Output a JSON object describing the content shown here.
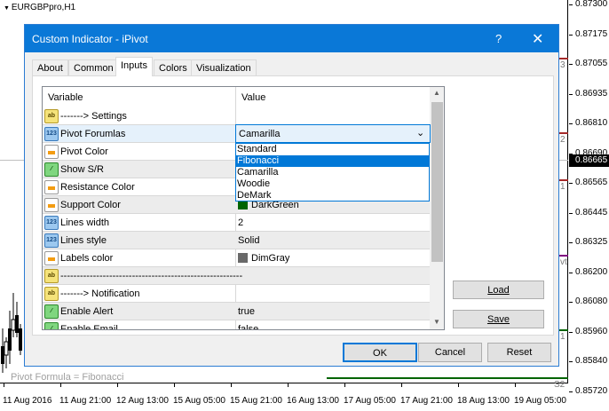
{
  "chart": {
    "symbol": "EURGBPpro,H1",
    "price_labels": [
      "0.87300",
      "0.87175",
      "0.87055",
      "0.86935",
      "0.86810",
      "0.86690",
      "0.86565",
      "0.86445",
      "0.86325",
      "0.86200",
      "0.86080",
      "0.85960",
      "0.85840",
      "0.85720"
    ],
    "current_price": "0.86665",
    "time_labels": [
      "11 Aug 2016",
      "11 Aug 21:00",
      "12 Aug 13:00",
      "15 Aug 05:00",
      "15 Aug 21:00",
      "16 Aug 13:00",
      "17 Aug 05:00",
      "17 Aug 21:00",
      "18 Aug 13:00",
      "19 Aug 05:00"
    ],
    "pivot_comment": "Pivot Formula = Fibonacci",
    "level_labels": [
      "3",
      "2",
      "1",
      "vt",
      "1",
      "S2"
    ],
    "colors": {
      "resistance": "#a52a2a",
      "pivot": "#800080",
      "support": "#006400"
    }
  },
  "dialog": {
    "title": "Custom Indicator - iPivot",
    "help": "?",
    "close": "✕",
    "tabs": [
      "About",
      "Common",
      "Inputs",
      "Colors",
      "Visualization"
    ],
    "active_tab": "Inputs",
    "columns": {
      "variable": "Variable",
      "value": "Value"
    },
    "rows": [
      {
        "icon": "ab",
        "variable": "-------> Settings",
        "value": ""
      },
      {
        "icon": "123",
        "variable": "Pivot Forumlas",
        "value": "Camarilla"
      },
      {
        "icon": "color",
        "variable": "Pivot Color",
        "value": ""
      },
      {
        "icon": "bool",
        "variable": "Show S/R",
        "value": ""
      },
      {
        "icon": "color",
        "variable": "Resistance Color",
        "value": ""
      },
      {
        "icon": "color",
        "variable": "Support Color",
        "value": "DarkGreen",
        "swatch": "#006400"
      },
      {
        "icon": "123",
        "variable": "Lines width",
        "value": "2"
      },
      {
        "icon": "123",
        "variable": "Lines style",
        "value": "Solid"
      },
      {
        "icon": "color",
        "variable": "Labels color",
        "value": "DimGray",
        "swatch": "#696969"
      },
      {
        "icon": "ab",
        "variable": "--------------------------------------------------------",
        "value": ""
      },
      {
        "icon": "ab",
        "variable": "-------> Notification",
        "value": ""
      },
      {
        "icon": "bool",
        "variable": "Enable Alert",
        "value": "true"
      },
      {
        "icon": "bool",
        "variable": "Enable Email",
        "value": "false"
      }
    ],
    "dropdown": {
      "selected": "Camarilla",
      "options": [
        "Standard",
        "Fibonacci",
        "Camarilla",
        "Woodie",
        "DeMark"
      ],
      "highlighted": "Fibonacci"
    },
    "load": "Load",
    "save": "Save",
    "ok": "OK",
    "cancel": "Cancel",
    "reset": "Reset"
  }
}
